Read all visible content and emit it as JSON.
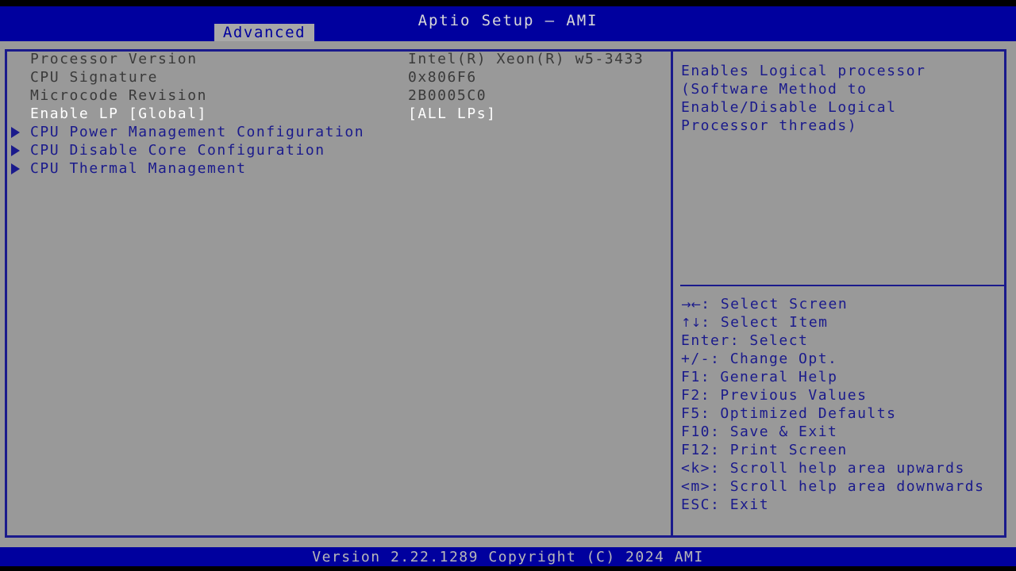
{
  "header": {
    "title": "Aptio Setup – AMI",
    "tabs": [
      {
        "label": "Advanced",
        "active": true
      }
    ]
  },
  "main": {
    "options": [
      {
        "type": "info",
        "label": "Processor Version",
        "value": "Intel(R) Xeon(R) w5-3433",
        "selected": false
      },
      {
        "type": "info",
        "label": "CPU Signature",
        "value": "0x806F6",
        "selected": false
      },
      {
        "type": "info",
        "label": "Microcode Revision",
        "value": "2B0005C0",
        "selected": false
      },
      {
        "type": "setting",
        "label": "Enable LP [Global]",
        "value": "[ALL LPs]",
        "selected": true
      },
      {
        "type": "submenu",
        "label": "CPU Power Management Configuration",
        "value": "",
        "selected": false
      },
      {
        "type": "submenu",
        "label": "CPU Disable Core Configuration",
        "value": "",
        "selected": false
      },
      {
        "type": "submenu",
        "label": "CPU Thermal Management",
        "value": "",
        "selected": false
      }
    ]
  },
  "help": {
    "text": "Enables Logical processor\n(Software Method to\nEnable/Disable Logical\nProcessor threads)"
  },
  "legend": {
    "items": [
      {
        "key": "→←",
        "glyph": true,
        "text": ": Select Screen"
      },
      {
        "key": "↑↓",
        "glyph": true,
        "text": ": Select Item"
      },
      {
        "key": "Enter",
        "glyph": false,
        "text": ": Select"
      },
      {
        "key": "+/-",
        "glyph": false,
        "text": ": Change Opt."
      },
      {
        "key": "F1",
        "glyph": false,
        "text": ": General Help"
      },
      {
        "key": "F2",
        "glyph": false,
        "text": ": Previous Values"
      },
      {
        "key": "F5",
        "glyph": false,
        "text": ": Optimized Defaults"
      },
      {
        "key": "F10",
        "glyph": false,
        "text": ": Save & Exit"
      },
      {
        "key": "F12",
        "glyph": false,
        "text": ": Print Screen"
      },
      {
        "key": "<k>",
        "glyph": false,
        "text": ": Scroll help area upwards"
      },
      {
        "key": "<m>",
        "glyph": false,
        "text": ": Scroll help area downwards"
      },
      {
        "key": "ESC",
        "glyph": false,
        "text": ": Exit"
      }
    ]
  },
  "footer": {
    "version": "Version 2.22.1289 Copyright (C) 2024 AMI"
  },
  "colors": {
    "header_blue": "#00009e",
    "body_gray": "#999999",
    "accent_blue": "#1a1a8c",
    "tab_gray": "#a8a8a8",
    "selected_white": "#ffffff",
    "info_text": "#3a3a3a"
  }
}
